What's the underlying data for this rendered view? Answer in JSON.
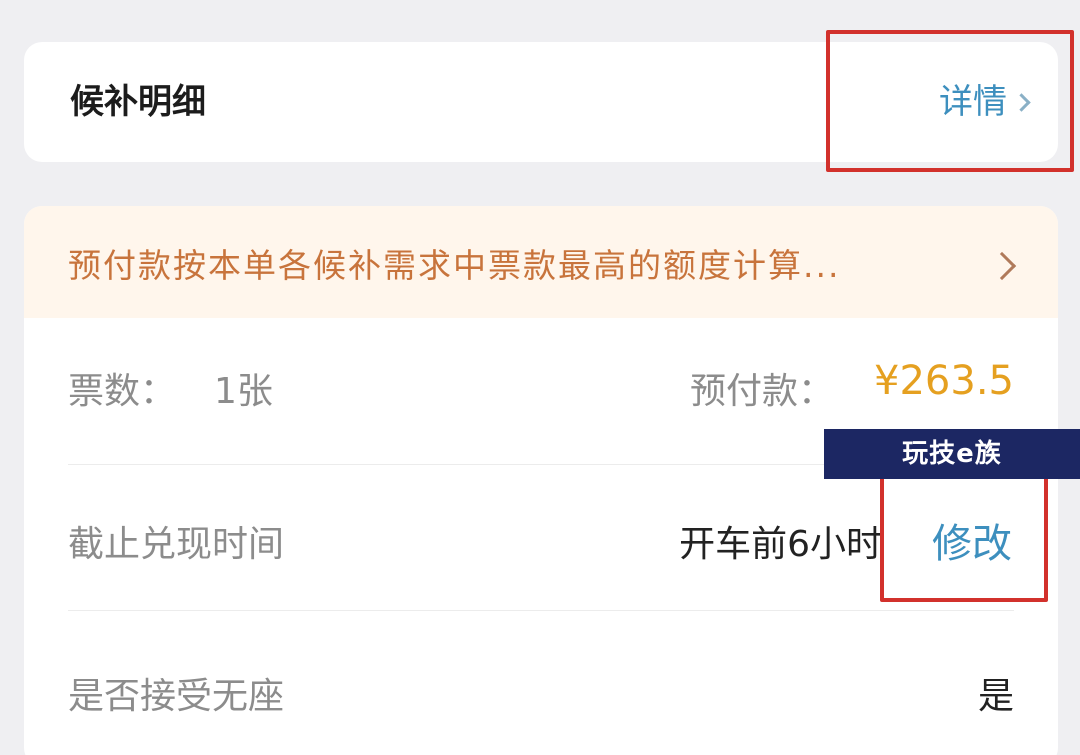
{
  "detail_card": {
    "title": "候补明细",
    "link_label": "详情"
  },
  "notice": {
    "text": "预付款按本单各候补需求中票款最高的额度计算..."
  },
  "tickets": {
    "label": "票数：",
    "count": "1张",
    "prepay_label": "预付款：",
    "prepay_amount": "¥263.5"
  },
  "deadline": {
    "label": "截止兑现时间",
    "value": "开车前6小时",
    "modify_label": "修改"
  },
  "no_seat": {
    "label": "是否接受无座",
    "value": "是"
  },
  "watermark": {
    "text": "玩技e族"
  },
  "colors": {
    "accent_link": "#3d8fbe",
    "price": "#e5a020",
    "notice_text": "#c8743c",
    "annotation_red": "#d2312c"
  }
}
